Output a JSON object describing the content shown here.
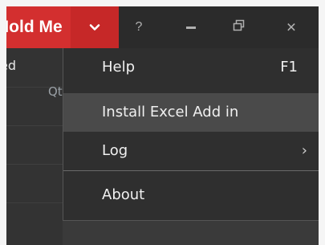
{
  "titlebar": {
    "title": "Hold Me"
  },
  "side": {
    "column_fragment": "ed",
    "sub_fragment": "Qt"
  },
  "menu": {
    "items": [
      {
        "label": "Help",
        "shortcut": "F1"
      },
      {
        "label": "Install Excel Add in"
      },
      {
        "label": "Log"
      },
      {
        "label": "About"
      }
    ]
  },
  "colors": {
    "accent": "#d32f2f",
    "menu_bg": "#2f2f2f",
    "hover_bg": "#4a4a4a"
  },
  "icons": {
    "dropdown": "chevron-down-icon",
    "help": "question-mark-icon",
    "minimize": "minimize-icon",
    "restore": "restore-icon",
    "close": "close-icon",
    "submenu": "chevron-right-icon"
  }
}
